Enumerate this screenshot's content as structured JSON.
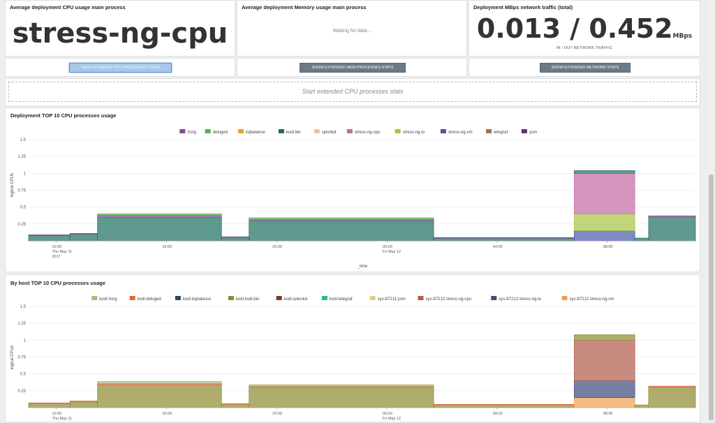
{
  "panels": {
    "cpu_main": {
      "title": "Average deployment CPU usage main process",
      "value": "stress-ng-cpu"
    },
    "mem_main": {
      "title": "Average deployment Memory usage main process",
      "status": "Waiting for data..."
    },
    "net": {
      "title": "Deployment MBps network traffic (total)",
      "value": "0.013 / 0.452",
      "unit": "MBps",
      "caption": "IN / OUT NETWORK TRAFFIC"
    }
  },
  "buttons": {
    "hide_cpu": "HIDE EXTENDED CPU PROCESSES STATS",
    "show_mem": "SHOW EXTENDED MEM PROCESSES STATS",
    "show_net": "SHOW EXTENDED NETWORK STATS"
  },
  "dropzone": {
    "label": "Start extended CPU processes stats"
  },
  "colors": {
    "active_button": "#a9c7ea",
    "button": "#6c7a86",
    "teal": "#4aa394"
  },
  "chart_data": [
    {
      "type": "area",
      "title": "Deployment TOP 10 CPU processes usage",
      "ylabel": "logical CPUs",
      "xlabel": "_time",
      "ylim": [
        0,
        1.5
      ],
      "yticks": [
        "0.25",
        "0.5",
        "0.75",
        "1",
        "1.25",
        "1.5"
      ],
      "xticks": [
        {
          "line1": "12:00",
          "line2": "Thu May 11",
          "line3": "2017"
        },
        {
          "line1": "16:00",
          "line2": "",
          "line3": ""
        },
        {
          "line1": "20:00",
          "line2": "",
          "line3": ""
        },
        {
          "line1": "00:00",
          "line2": "Fri May 12",
          "line3": ""
        },
        {
          "line1": "04:00",
          "line2": "",
          "line3": ""
        },
        {
          "line1": "08:00",
          "line2": "",
          "line3": ""
        }
      ],
      "legend_position": "top",
      "legend": [
        {
          "name": "Xorg",
          "color": "#7b4f8e"
        },
        {
          "name": "deluged",
          "color": "#5cae54"
        },
        {
          "name": "irqbalance",
          "color": "#e8a427"
        },
        {
          "name": "kodi.bin",
          "color": "#1d6e5c"
        },
        {
          "name": "splunkd",
          "color": "#f4c18e"
        },
        {
          "name": "stress-ng-cpu",
          "color": "#c36aa2"
        },
        {
          "name": "stress-ng-io",
          "color": "#a7c543"
        },
        {
          "name": "stress-ng-vm",
          "color": "#4957a8"
        },
        {
          "name": "telegraf",
          "color": "#987a3a"
        },
        {
          "name": "yum",
          "color": "#5a3470"
        }
      ],
      "segments": [
        {
          "start": 11.0,
          "end": 12.5,
          "stack": {
            "kodi.bin": 0.08,
            "Xorg": 0.01
          }
        },
        {
          "start": 12.5,
          "end": 13.5,
          "stack": {
            "kodi.bin": 0.1,
            "Xorg": 0.01
          }
        },
        {
          "start": 13.5,
          "end": 18.0,
          "stack": {
            "kodi.bin": 0.35,
            "Xorg": 0.03,
            "deluged": 0.02
          }
        },
        {
          "start": 18.0,
          "end": 19.0,
          "stack": {
            "kodi.bin": 0.05,
            "Xorg": 0.01
          }
        },
        {
          "start": 19.0,
          "end": 25.7,
          "stack": {
            "kodi.bin": 0.3,
            "Xorg": 0.02,
            "deluged": 0.02
          }
        },
        {
          "start": 25.7,
          "end": 30.8,
          "stack": {
            "kodi.bin": 0.04,
            "Xorg": 0.01
          }
        },
        {
          "start": 30.8,
          "end": 33.0,
          "stack": {
            "stress-ng-vm": 0.15,
            "stress-ng-io": 0.25,
            "stress-ng-cpu": 0.6,
            "kodi.bin": 0.04
          }
        },
        {
          "start": 33.0,
          "end": 33.5,
          "stack": {
            "kodi.bin": 0.04
          }
        },
        {
          "start": 33.5,
          "end": 35.2,
          "stack": {
            "kodi.bin": 0.35,
            "Xorg": 0.02
          }
        }
      ]
    },
    {
      "type": "area",
      "title": "By host TOP 10 CPU processes usage",
      "ylabel": "logical CPUs",
      "ylim": [
        0,
        1.5
      ],
      "yticks": [
        "0.25",
        "0.5",
        "0.75",
        "1",
        "1.25",
        "1.5"
      ],
      "xticks": [
        {
          "line1": "12:00",
          "line2": "Thu May 11",
          "line3": ""
        },
        {
          "line1": "16:00",
          "line2": "",
          "line3": ""
        },
        {
          "line1": "20:00",
          "line2": "",
          "line3": ""
        },
        {
          "line1": "00:00",
          "line2": "Fri May 12",
          "line3": ""
        },
        {
          "line1": "04:00",
          "line2": "",
          "line3": ""
        },
        {
          "line1": "08:00",
          "line2": "",
          "line3": ""
        }
      ],
      "legend_position": "top",
      "legend": [
        {
          "name": "kodi:Xorg",
          "color": "#9fbf7a"
        },
        {
          "name": "kodi:deluged",
          "color": "#e0663a"
        },
        {
          "name": "kodi:irqbalance",
          "color": "#2e4a5c"
        },
        {
          "name": "kodi:kodi.bin",
          "color": "#8c8a2e"
        },
        {
          "name": "kodi:splunkd",
          "color": "#7a3b2a"
        },
        {
          "name": "kodi:telegraf",
          "color": "#2fb49a"
        },
        {
          "name": "sys-87211:yum",
          "color": "#e6c98a"
        },
        {
          "name": "sys-87212:stress-ng-cpu",
          "color": "#b05a4a"
        },
        {
          "name": "sys-87212:stress-ng-io",
          "color": "#3f4a7a"
        },
        {
          "name": "sys-87212:stress-ng-vm",
          "color": "#eea052"
        }
      ],
      "segments": [
        {
          "start": 11.0,
          "end": 12.5,
          "stack": {
            "kodi:kodi.bin": 0.06,
            "kodi:deluged": 0.01
          }
        },
        {
          "start": 12.5,
          "end": 13.5,
          "stack": {
            "kodi:kodi.bin": 0.09,
            "kodi:deluged": 0.01
          }
        },
        {
          "start": 13.5,
          "end": 18.0,
          "stack": {
            "kodi:kodi.bin": 0.34,
            "kodi:deluged": 0.02,
            "kodi:Xorg": 0.03
          }
        },
        {
          "start": 18.0,
          "end": 19.0,
          "stack": {
            "kodi:kodi.bin": 0.05,
            "kodi:deluged": 0.01
          }
        },
        {
          "start": 19.0,
          "end": 25.7,
          "stack": {
            "kodi:kodi.bin": 0.3,
            "kodi:deluged": 0.02,
            "kodi:Xorg": 0.02
          }
        },
        {
          "start": 25.7,
          "end": 30.8,
          "stack": {
            "kodi:kodi.bin": 0.04,
            "kodi:deluged": 0.01
          }
        },
        {
          "start": 30.8,
          "end": 33.0,
          "stack": {
            "sys-87212:stress-ng-vm": 0.15,
            "sys-87212:stress-ng-io": 0.25,
            "sys-87212:stress-ng-cpu": 0.6,
            "kodi:kodi.bin": 0.08
          }
        },
        {
          "start": 33.0,
          "end": 33.5,
          "stack": {
            "kodi:kodi.bin": 0.04
          }
        },
        {
          "start": 33.5,
          "end": 35.2,
          "stack": {
            "kodi:kodi.bin": 0.3,
            "kodi:deluged": 0.02
          }
        }
      ]
    }
  ]
}
